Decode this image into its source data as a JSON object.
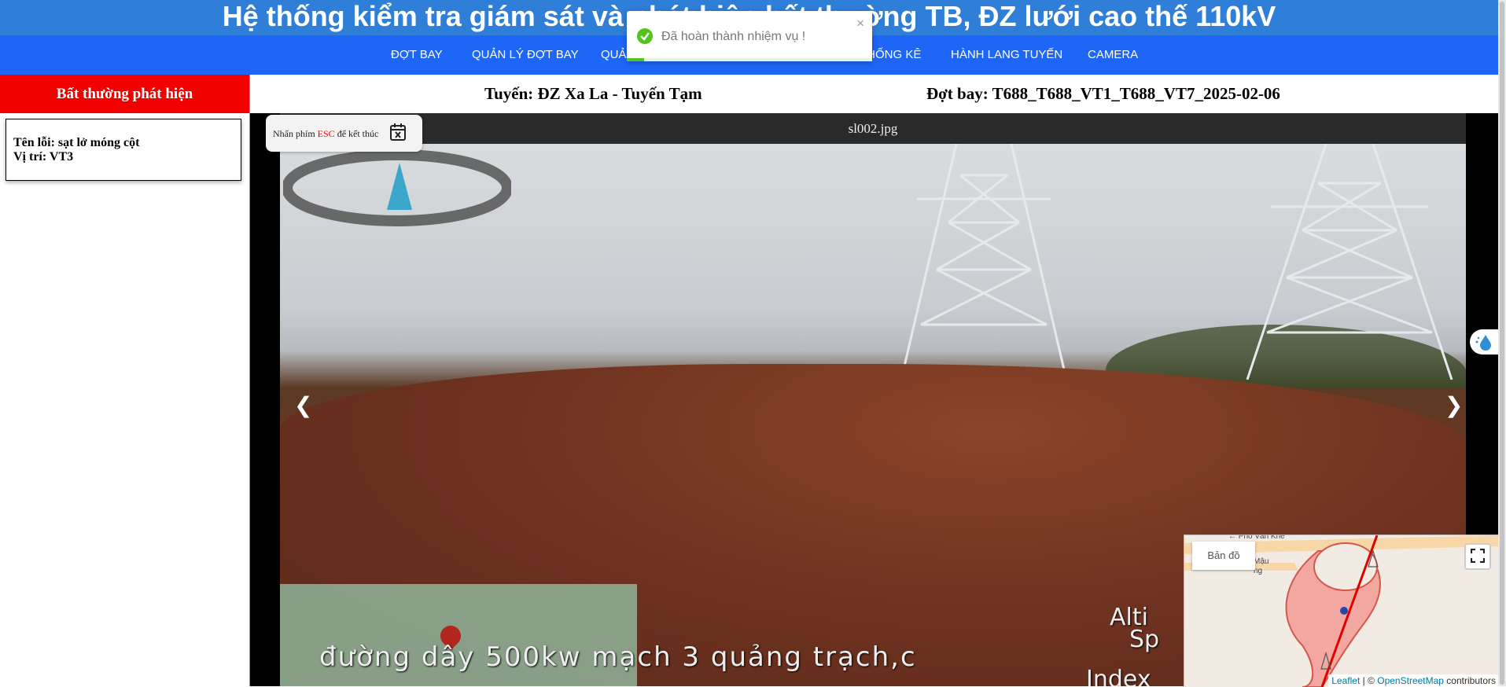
{
  "header": {
    "title": "Hệ thống kiểm tra giám sát và phát hiện bất thường TB, ĐZ lưới cao thế 110kV"
  },
  "nav": {
    "items": [
      "ĐỢT BAY",
      "QUẢN LÝ ĐỢT BAY",
      "QUẢN",
      "THỐNG KÊ",
      "HÀNH LANG TUYẾN",
      "CAMERA"
    ]
  },
  "sidebar": {
    "header": "Bất thường phát hiện",
    "card": {
      "name_line": "Tên lỗi: sạt lở móng cột",
      "pos_line": "Vị trí: VT3"
    }
  },
  "infobar": {
    "route": "Tuyến: ĐZ Xa La - Tuyến Tạm",
    "flight": "Đợt bay: T688_T688_VT1_T688_VT7_2025-02-06"
  },
  "viewer": {
    "filename": "sl002.jpg",
    "prev": "❮",
    "next": "❯",
    "photo_caption": "đường dây 500kw mạch 3 quảng trạch,c",
    "photo_right_1": "Alti",
    "photo_right_2": "Sp",
    "photo_right_3": "Index"
  },
  "esc_hint": {
    "before": "Nhấn phím",
    "key": "ESC",
    "after": "để kết thúc"
  },
  "toast": {
    "message": "Đã hoàn thành nhiệm vụ !",
    "close": "×",
    "progress_fraction": 0.07
  },
  "minimap": {
    "label": "Bản đồ",
    "fullscreen": "⛶",
    "street_1": "← Phố Văn Khê",
    "street_2": "Mậu",
    "street_3": "ng",
    "attrib_leaflet": "Leaflet",
    "attrib_sep": " | © ",
    "attrib_osm": "OpenStreetMap",
    "attrib_contrib": " contributors"
  },
  "colors": {
    "topbar": "#2f7ed8",
    "nav": "#1e66f5",
    "alert_red": "#f20000",
    "success_green": "#52c41a"
  }
}
